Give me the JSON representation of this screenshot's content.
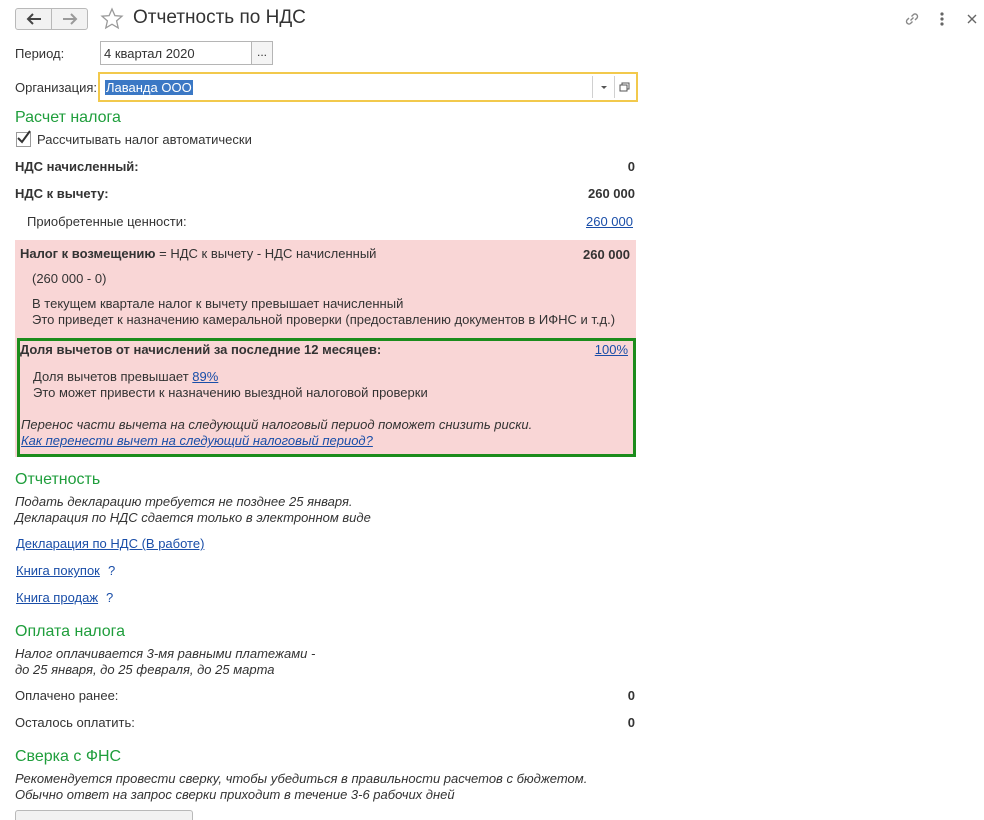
{
  "header": {
    "title": "Отчетность по НДС"
  },
  "filters": {
    "period_label": "Период:",
    "period_value": "4 квартал 2020",
    "period_select_label": "...",
    "org_label": "Организация:",
    "org_value": "Лаванда ООО"
  },
  "calc": {
    "section_title": "Расчет налога",
    "auto_checkbox_label": "Рассчитывать налог автоматически",
    "auto_checked": true,
    "vat_accrued_label": "НДС начисленный:",
    "vat_accrued_value": "0",
    "vat_deduct_label": "НДС к вычету:",
    "vat_deduct_value": "260 000",
    "acquired_label": "Приобретенные ценности:",
    "acquired_value": "260 000"
  },
  "refund": {
    "label_bold": "Налог к возмещению",
    "label_rest": " = НДС к вычету - НДС начисленный",
    "value": "260 000",
    "formula": "(260 000 - 0)",
    "warning_line1": "В текущем квартале налог к вычету превышает начисленный",
    "warning_line2": "Это приведет к назначению камеральной проверки (предоставлению документов в ИФНС и т.д.)"
  },
  "deduction_share": {
    "label": "Доля вычетов от начислений за последние 12 месяцев:",
    "value": "100%",
    "exceeds_text": "Доля вычетов превышает ",
    "exceeds_link": "89%",
    "risk_text": "Это может привести к назначению выездной налоговой проверки",
    "advice_text": "Перенос части вычета на следующий налоговый период поможет снизить риски.",
    "advice_link": "Как перенести вычет на следующий налоговый период?"
  },
  "reporting": {
    "section_title": "Отчетность",
    "note_line1": "Подать декларацию требуется не позднее 25 января.",
    "note_line2": "Декларация по НДС сдается только в электронном виде",
    "declaration_link": "Декларация по НДС (В работе)",
    "purchases_link": "Книга покупок",
    "sales_link": "Книга продаж",
    "help_mark": "?"
  },
  "payment": {
    "section_title": "Оплата налога",
    "note_line1": "Налог оплачивается 3-мя равными платежами -",
    "note_line2": "до 25 января, до 25 февраля, до 25 марта",
    "paid_label": "Оплачено ранее:",
    "paid_value": "0",
    "remaining_label": "Осталось оплатить:",
    "remaining_value": "0"
  },
  "reconciliation": {
    "section_title": "Сверка с ФНС",
    "note_line1": "Рекомендуется провести сверку, чтобы убедиться в правильности расчетов с бюджетом.",
    "note_line2": "Обычно ответ на запрос сверки приходит в течение 3-6 рабочих дней"
  },
  "colors": {
    "section_green": "#1f9e3c",
    "link_blue": "#1a4ea8",
    "warning_pink": "#f9d6d6",
    "highlight_green_border": "#1c8c1c",
    "focus_yellow": "#f2c94c"
  }
}
